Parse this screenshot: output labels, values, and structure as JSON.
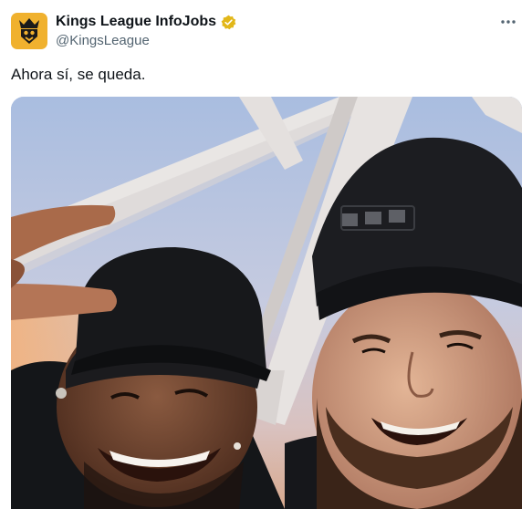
{
  "account": {
    "display_name": "Kings League InfoJobs",
    "handle": "@KingsLeague",
    "avatar_icon": "kings-league-crown-logo",
    "verified_icon": "verified-gold-badge-icon"
  },
  "tweet": {
    "text": "Ahora sí, se queda."
  },
  "actions": {
    "more_icon": "more-options-icon"
  },
  "media": {
    "type": "photo",
    "content": "selfie of two smiling men in black caps under a metal bridge structure"
  },
  "colors": {
    "avatar_bg": "#f0b12e",
    "verified_gold": "#e2b719",
    "text_primary": "#0f1419",
    "text_secondary": "#536471"
  }
}
